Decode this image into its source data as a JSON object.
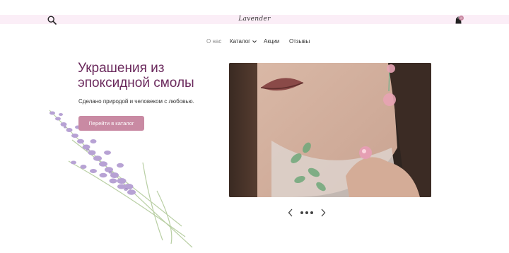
{
  "header": {
    "logo_text": "Lavender",
    "search_icon": "search-icon",
    "cart_icon": "shopping-bag-icon",
    "cart_count": "0"
  },
  "nav": {
    "items": [
      {
        "label": "О нас",
        "active": true
      },
      {
        "label": "Каталог",
        "has_dropdown": true
      },
      {
        "label": "Акции"
      },
      {
        "label": "Отзывы"
      }
    ]
  },
  "hero": {
    "title_line1": "Украшения из",
    "title_line2": "эпоксидной смолы",
    "subtitle": "Сделано природой и человеком с любовью.",
    "cta_label": "Перейти в каталог",
    "image_icon": "hero-photo",
    "decoration_icon": "lavender-sprig-icon"
  },
  "carousel": {
    "prev_icon": "chevron-left-icon",
    "next_icon": "chevron-right-icon",
    "slide_count": 3,
    "active_index": 1
  },
  "colors": {
    "topbar_bg": "#fbeef7",
    "title_color": "#6b2a5d",
    "accent": "#c98aa3",
    "lavender": "#a98bc6"
  }
}
